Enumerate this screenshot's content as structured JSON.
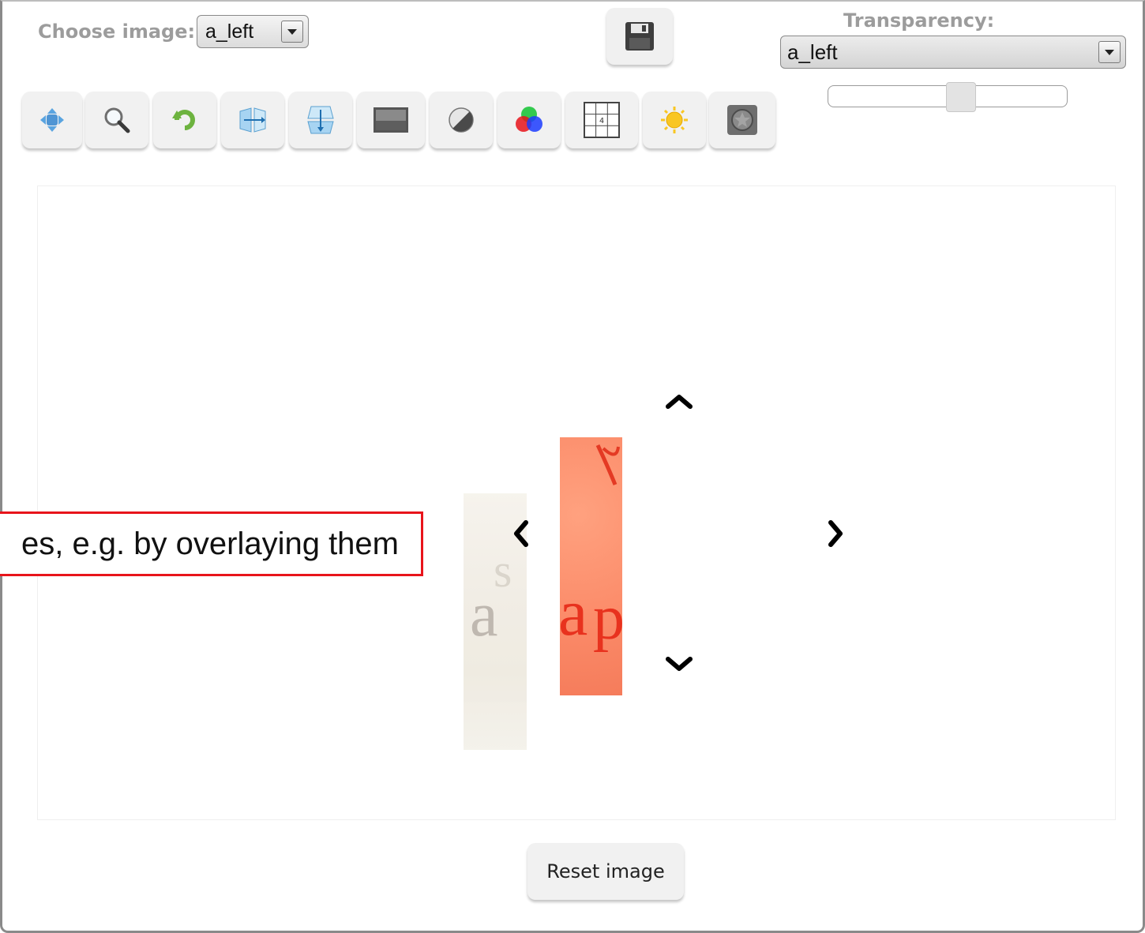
{
  "header": {
    "choose_image_label": "Choose image:",
    "choose_image_value": "a_left",
    "transparency_label": "Transparency:",
    "transparency_value": "a_left",
    "transparency_slider": 0.56
  },
  "toolbar": {
    "tools": [
      {
        "name": "move-icon"
      },
      {
        "name": "zoom-icon"
      },
      {
        "name": "rotate-icon"
      },
      {
        "name": "flip-horizontal-icon"
      },
      {
        "name": "flip-vertical-icon"
      },
      {
        "name": "grayscale-icon"
      },
      {
        "name": "contrast-icon"
      },
      {
        "name": "color-channels-icon"
      },
      {
        "name": "convolution-icon"
      },
      {
        "name": "brightness-icon"
      },
      {
        "name": "invert-icon"
      }
    ]
  },
  "canvas": {
    "callout_text": "es, e.g. by overlaying them"
  },
  "actions": {
    "reset_label": "Reset image"
  },
  "colors": {
    "callout_border": "#e8141b",
    "label_gray": "#9c9c9c",
    "image_right_tint": "#fb8a68"
  }
}
